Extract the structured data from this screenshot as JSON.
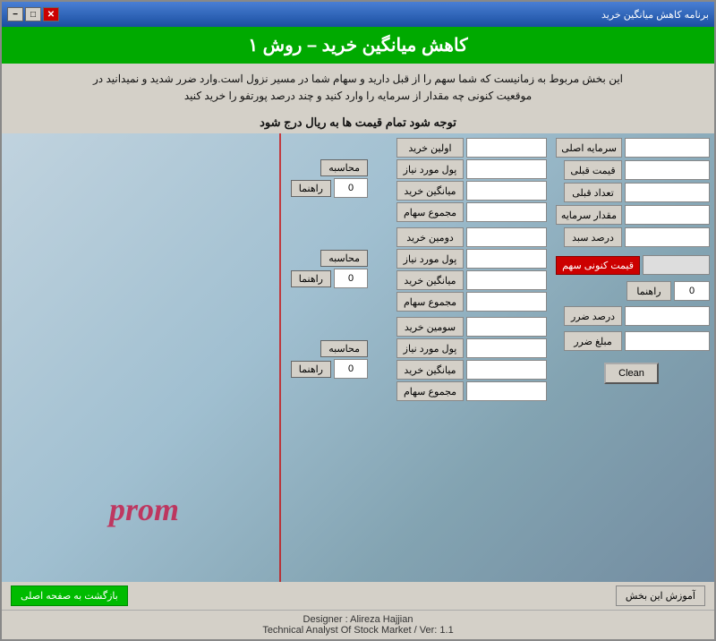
{
  "window": {
    "title": "برنامه کاهش میانگین خرید",
    "min_btn": "−",
    "max_btn": "□",
    "close_btn": "✕"
  },
  "header": {
    "title": "کاهش میانگین خرید – روش ۱"
  },
  "description": {
    "line1": "این بخش مربوط به زمانیست که شما سهم را از قبل دارید و سهام شما در مسیر نزول است.وارد ضرر شدید و نمیدانید در",
    "line2": "موقعیت کنونی چه مقدار از سرمایه را وارد کنید و چند درصد پورتفو را خرید کنید",
    "notice": "توجه شود تمام قیمت ها به ریال درج شود"
  },
  "right_panel": {
    "fields": [
      {
        "label": "سرمایه اصلی",
        "value": ""
      },
      {
        "label": "قیمت قبلی",
        "value": ""
      },
      {
        "label": "تعداد قبلی",
        "value": ""
      },
      {
        "label": "مقدار سرمایه",
        "value": ""
      },
      {
        "label": "درصد سبد",
        "value": ""
      }
    ],
    "current_price_label": "قیمت کنونی سهم",
    "current_price_value": "",
    "rahma_label": "راهنما",
    "rahma_value": "0",
    "darsd_zarr_label": "درصد ضرر",
    "darsd_zarr_value": "",
    "mablagh_zarr_label": "مبلغ ضرر",
    "mablagh_zarr_value": "",
    "clean_btn": "Clean"
  },
  "buy_groups": [
    {
      "title": "اولین خرید",
      "pol_label": "پول مورد نیاز",
      "avg_label": "میانگین خرید",
      "sum_label": "مجموع سهام",
      "calc_btn": "محاسبه",
      "rahma_btn": "راهنما",
      "rahma_value": "0",
      "input1": "",
      "input2": "",
      "input3": "",
      "input4": ""
    },
    {
      "title": "دومین خرید",
      "pol_label": "پول مورد نیاز",
      "avg_label": "میانگین خرید",
      "sum_label": "مجموع سهام",
      "calc_btn": "محاسبه",
      "rahma_btn": "راهنما",
      "rahma_value": "0",
      "input1": "",
      "input2": "",
      "input3": "",
      "input4": ""
    },
    {
      "title": "سومین خرید",
      "pol_label": "پول مورد نیاز",
      "avg_label": "میانگین خرید",
      "sum_label": "مجموع سهام",
      "calc_btn": "محاسبه",
      "rahma_btn": "راهنما",
      "rahma_value": "0",
      "input1": "",
      "input2": "",
      "input3": "",
      "input4": ""
    }
  ],
  "helper_panel": {
    "rahma_btn": "راهنما",
    "rahma_value": "0",
    "rahma2_btn": "راهنما",
    "rahma2_value": "0",
    "rahma3_btn": "راهنما",
    "rahma3_value": "0"
  },
  "bottom": {
    "teach_btn": "آموزش این بخش",
    "back_btn": "بازگشت به صفحه اصلی"
  },
  "footer": {
    "line1": "Designer : Alireza Hajjian",
    "line2": "Technical Analyst Of Stock Market / Ver: 1.1"
  },
  "prom_text": "prom"
}
